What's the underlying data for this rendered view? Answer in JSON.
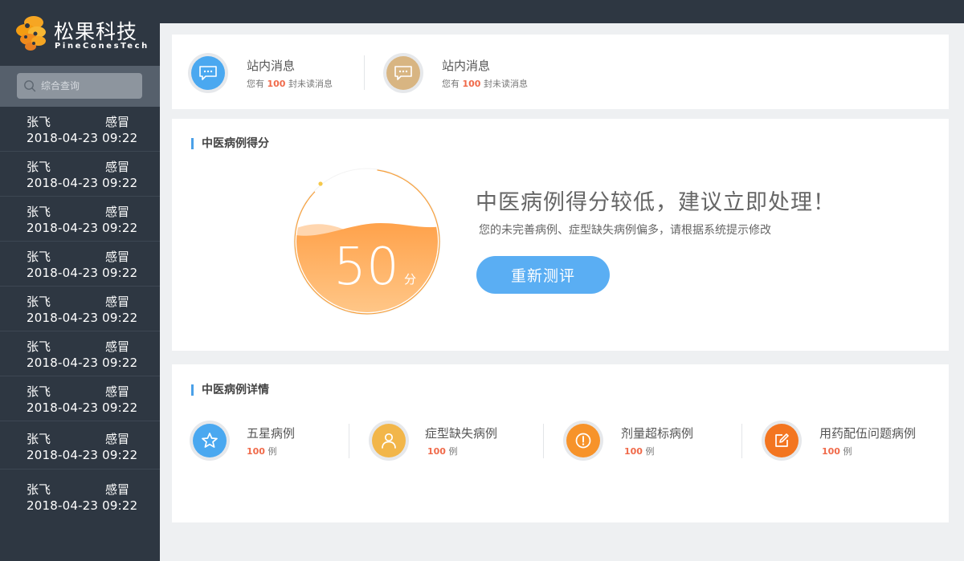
{
  "brand": {
    "name": "松果科技",
    "subtitle": "PineConesTech"
  },
  "search": {
    "placeholder": "综合查询"
  },
  "patients": [
    {
      "name": "张飞",
      "diagnosis": "感冒",
      "time": "2018-04-23  09:22"
    },
    {
      "name": "张飞",
      "diagnosis": "感冒",
      "time": "2018-04-23  09:22"
    },
    {
      "name": "张飞",
      "diagnosis": "感冒",
      "time": "2018-04-23  09:22"
    },
    {
      "name": "张飞",
      "diagnosis": "感冒",
      "time": "2018-04-23  09:22"
    },
    {
      "name": "张飞",
      "diagnosis": "感冒",
      "time": "2018-04-23  09:22"
    },
    {
      "name": "张飞",
      "diagnosis": "感冒",
      "time": "2018-04-23  09:22"
    },
    {
      "name": "张飞",
      "diagnosis": "感冒",
      "time": "2018-04-23  09:22"
    },
    {
      "name": "张飞",
      "diagnosis": "感冒",
      "time": "2018-04-23  09:22"
    },
    {
      "name": "张飞",
      "diagnosis": "感冒",
      "time": "2018-04-23  09:22"
    }
  ],
  "messages": [
    {
      "title": "站内消息",
      "prefix": "您有",
      "count": "100",
      "suffix": "封未读消息",
      "icon": "chat-bubble-icon",
      "color": "#4aa8f0"
    },
    {
      "title": "站内消息",
      "prefix": "您有",
      "count": "100",
      "suffix": "封未读消息",
      "icon": "chat-bubble-icon",
      "color": "#d8b582"
    }
  ],
  "score_section": {
    "title": "中医病例得分",
    "score": "50",
    "unit": "分",
    "headline": "中医病例得分较低，建议立即处理！",
    "description": "您的未完善病例、症型缺失病例偏多，请根据系统提示修改",
    "button_label": "重新测评",
    "fill_fraction": 0.5,
    "colors": {
      "fill_top": "#ffa24b",
      "fill_bottom": "#ffc88a",
      "ring": "#f7a03c"
    }
  },
  "detail_section": {
    "title": "中医病例详情",
    "items": [
      {
        "title": "五星病例",
        "count": "100",
        "unit": "例",
        "icon": "star-icon",
        "color": "#4aa8f0"
      },
      {
        "title": "症型缺失病例",
        "count": "100",
        "unit": "例",
        "icon": "person-icon",
        "color": "#f2b64a"
      },
      {
        "title": "剂量超标病例",
        "count": "100",
        "unit": "例",
        "icon": "exclamation-icon",
        "color": "#f7932a"
      },
      {
        "title": "用药配伍问题病例",
        "count": "100",
        "unit": "例",
        "icon": "edit-icon",
        "color": "#f37520"
      }
    ]
  }
}
